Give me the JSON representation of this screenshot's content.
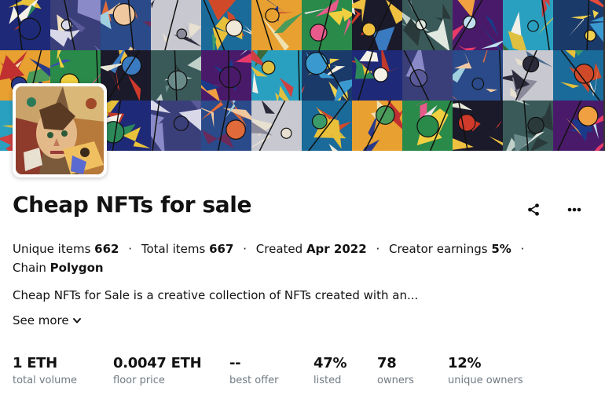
{
  "collection": {
    "title": "Cheap NFTs for sale",
    "description": "Cheap NFTs for Sale is a creative collection of NFTs created with an...",
    "see_more_label": "See more"
  },
  "actions": {
    "share_icon": "share-icon",
    "more_icon": "more-horizontal-icon"
  },
  "meta": {
    "unique_items_label": "Unique items",
    "unique_items_value": "662",
    "total_items_label": "Total items",
    "total_items_value": "667",
    "created_label": "Created",
    "created_value": "Apr 2022",
    "creator_earnings_label": "Creator earnings",
    "creator_earnings_value": "5%",
    "chain_label": "Chain",
    "chain_value": "Polygon",
    "separator": "·"
  },
  "stats": [
    {
      "value": "1 ETH",
      "label": "total volume"
    },
    {
      "value": "0.0047 ETH",
      "label": "floor price"
    },
    {
      "value": "--",
      "label": "best offer"
    },
    {
      "value": "47%",
      "label": "listed"
    },
    {
      "value": "78",
      "label": "owners"
    },
    {
      "value": "12%",
      "label": "unique owners"
    }
  ]
}
